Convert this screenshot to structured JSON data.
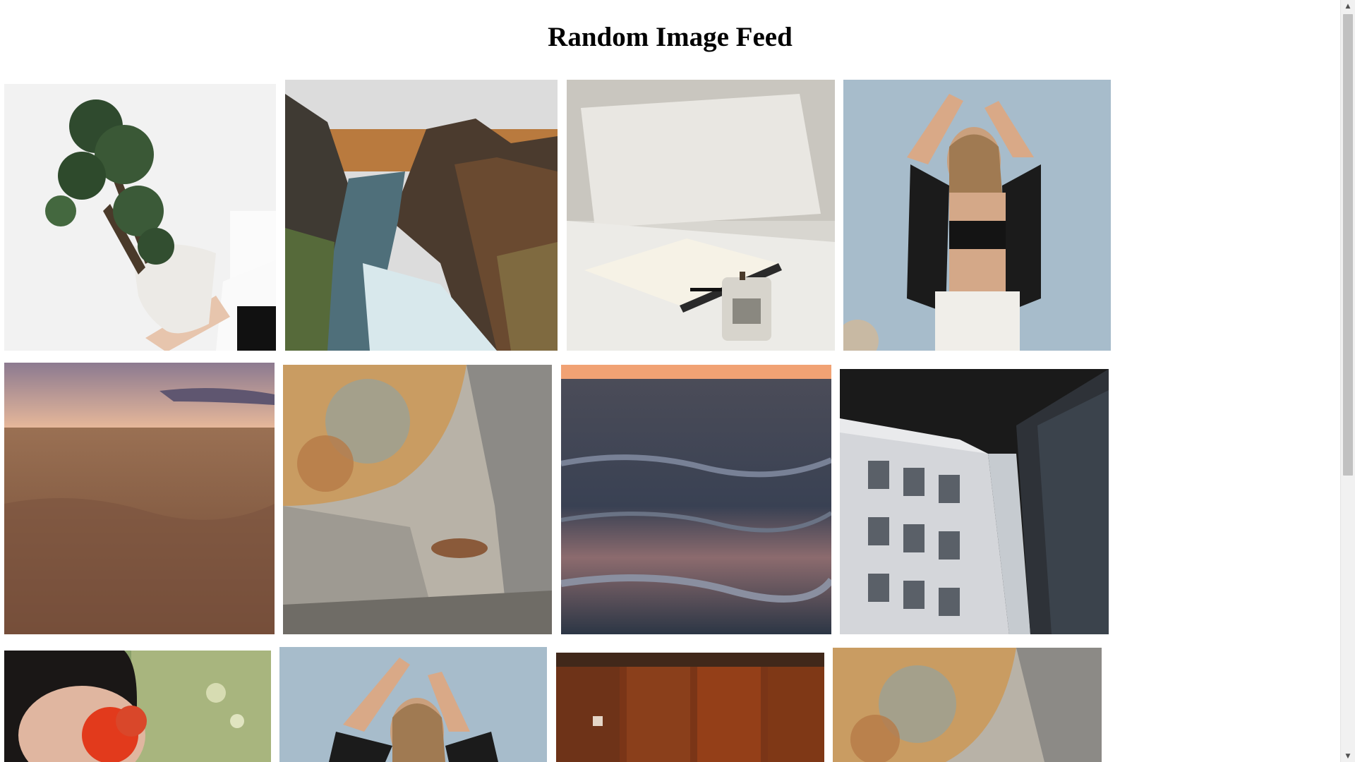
{
  "page": {
    "title": "Random Image Feed"
  },
  "feed": {
    "images": [
      {
        "subject": "potted-plant",
        "row": 1,
        "col": 1
      },
      {
        "subject": "river-canyon",
        "row": 1,
        "col": 2
      },
      {
        "subject": "notebook-candle",
        "row": 1,
        "col": 3
      },
      {
        "subject": "woman-arms-raised",
        "row": 1,
        "col": 4
      },
      {
        "subject": "wheat-field-sunset",
        "row": 2,
        "col": 1
      },
      {
        "subject": "baroque-ceiling",
        "row": 2,
        "col": 2
      },
      {
        "subject": "ocean-waves-sunset",
        "row": 2,
        "col": 3
      },
      {
        "subject": "modern-buildings",
        "row": 2,
        "col": 4
      },
      {
        "subject": "woman-poppy",
        "row": 3,
        "col": 1
      },
      {
        "subject": "woman-arms-raised",
        "row": 3,
        "col": 2
      },
      {
        "subject": "orange-building-facade",
        "row": 3,
        "col": 3
      },
      {
        "subject": "baroque-ceiling",
        "row": 3,
        "col": 4
      }
    ]
  },
  "scrollbar": {
    "up_icon": "▲",
    "down_icon": "▼"
  }
}
